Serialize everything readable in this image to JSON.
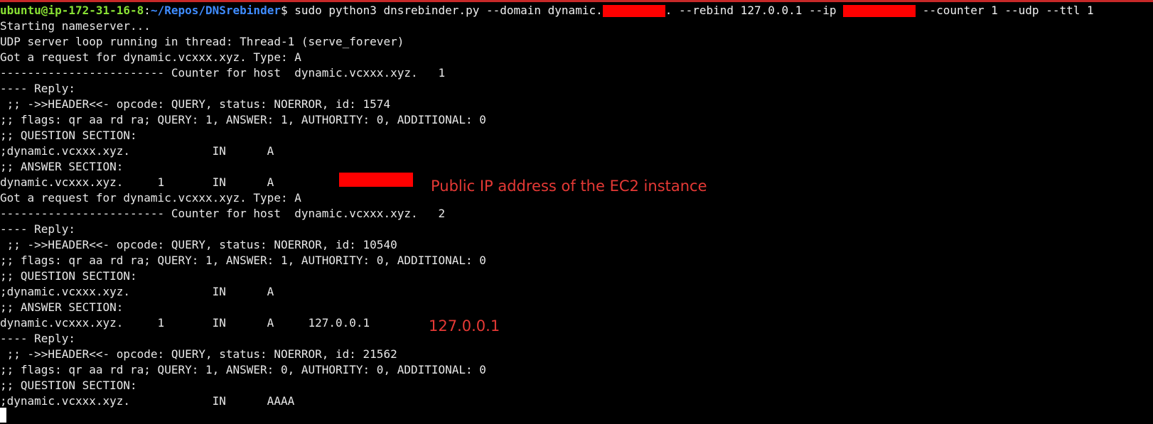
{
  "prompt": {
    "user_host": "ubuntu@ip-172-31-16-8",
    "separator": ":",
    "path": "~/Repos/DNSrebinder",
    "symbol": "$",
    "command_part1": " sudo python3 dnsrebinder.py --domain dynamic.",
    "command_part2": ". --rebind 127.0.0.1 --ip ",
    "command_part3": " --counter 1 --udp --ttl 1"
  },
  "output": [
    "Starting nameserver...",
    "UDP server loop running in thread: Thread-1 (serve_forever)",
    "Got a request for dynamic.vcxxx.xyz. Type: A",
    "------------------------ Counter for host  dynamic.vcxxx.xyz.   1",
    "---- Reply:",
    " ;; ->>HEADER<<- opcode: QUERY, status: NOERROR, id: 1574",
    ";; flags: qr aa rd ra; QUERY: 1, ANSWER: 1, AUTHORITY: 0, ADDITIONAL: 0",
    ";; QUESTION SECTION:",
    ";dynamic.vcxxx.xyz.            IN      A",
    ";; ANSWER SECTION:",
    "dynamic.vcxxx.xyz.     1       IN      A",
    "Got a request for dynamic.vcxxx.xyz. Type: A",
    "------------------------ Counter for host  dynamic.vcxxx.xyz.   2",
    "---- Reply:",
    " ;; ->>HEADER<<- opcode: QUERY, status: NOERROR, id: 10540",
    ";; flags: qr aa rd ra; QUERY: 1, ANSWER: 1, AUTHORITY: 0, ADDITIONAL: 0",
    ";; QUESTION SECTION:",
    ";dynamic.vcxxx.xyz.            IN      A",
    ";; ANSWER SECTION:",
    "dynamic.vcxxx.xyz.     1       IN      A     127.0.0.1",
    "---- Reply:",
    " ;; ->>HEADER<<- opcode: QUERY, status: NOERROR, id: 21562",
    ";; flags: qr aa rd ra; QUERY: 1, ANSWER: 0, AUTHORITY: 0, ADDITIONAL: 0",
    ";; QUESTION SECTION:",
    ";dynamic.vcxxx.xyz.            IN      AAAA"
  ],
  "annotations": {
    "public_ip_note": "Public IP address of the EC2 instance",
    "localhost_note": "127.0.0.1"
  },
  "colors": {
    "background": "#000000",
    "text": "#e8e8e8",
    "prompt_user": "#8ae234",
    "prompt_path": "#3f8cff",
    "redaction": "#ff0000",
    "annotation": "#e53935"
  }
}
